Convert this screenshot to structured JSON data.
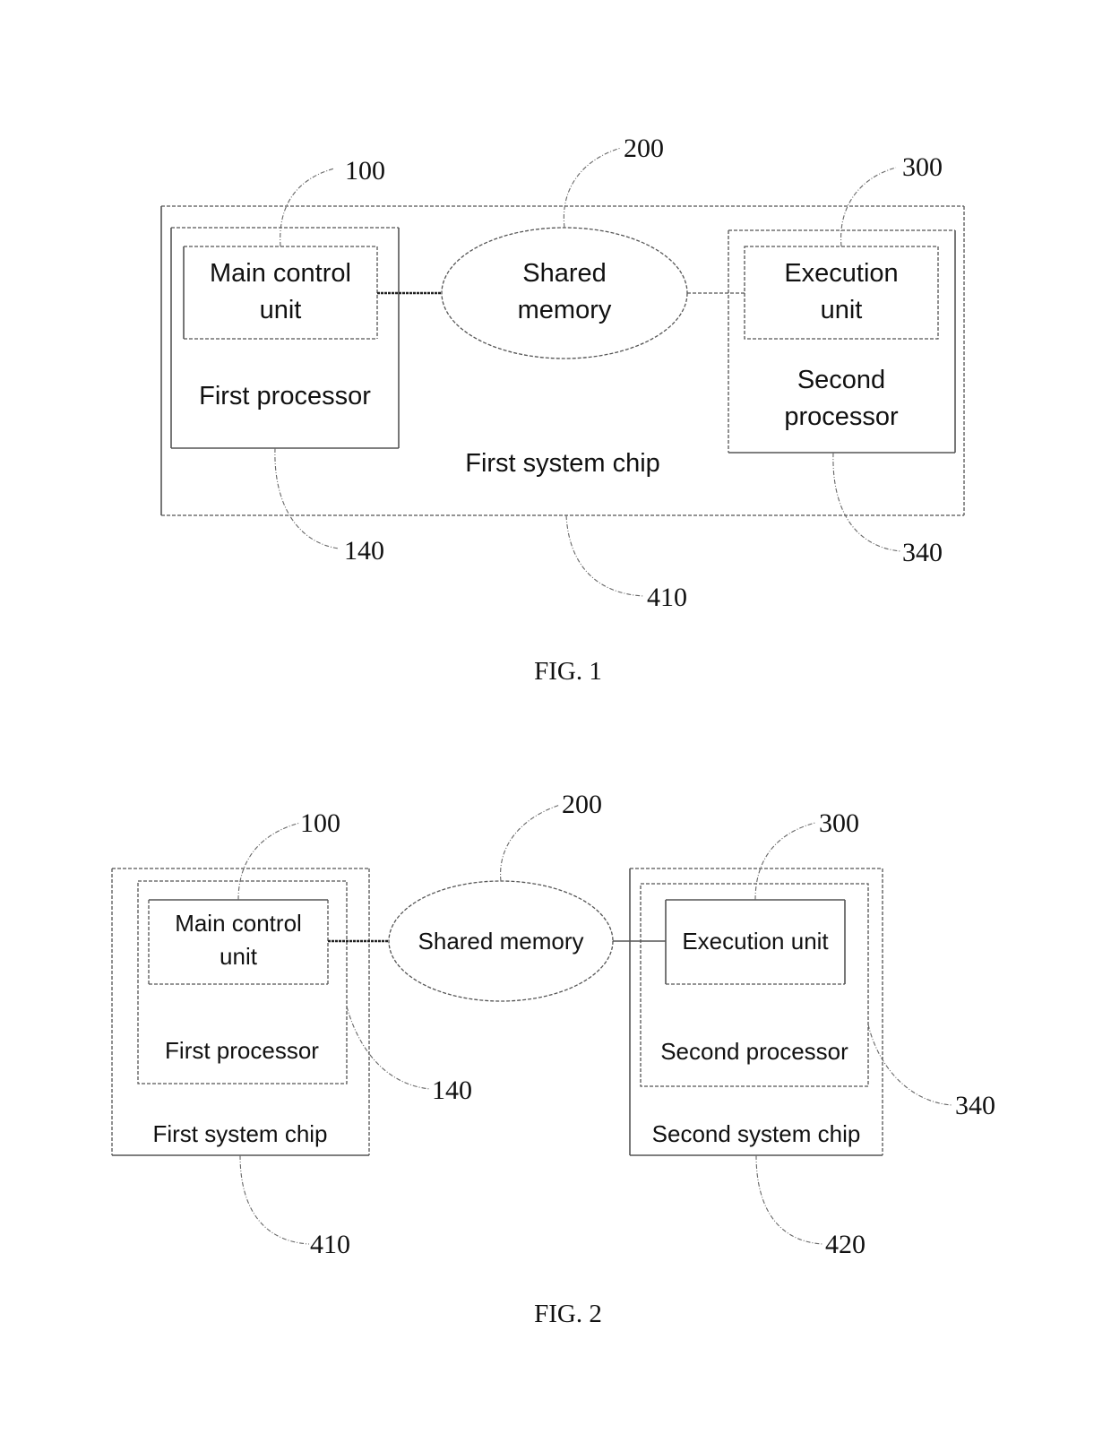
{
  "figures": [
    {
      "caption": "FIG. 1",
      "nodes": {
        "main_control_unit": {
          "lines": [
            "Main control",
            "unit"
          ],
          "ref": "100"
        },
        "first_processor": {
          "lines": [
            "First processor"
          ],
          "ref": "140"
        },
        "shared_memory": {
          "lines": [
            "Shared",
            "memory"
          ],
          "ref": "200"
        },
        "execution_unit": {
          "lines": [
            "Execution",
            "unit"
          ],
          "ref": "300"
        },
        "second_processor": {
          "lines": [
            "Second",
            "processor"
          ],
          "ref": "340"
        },
        "first_system_chip": {
          "lines": [
            "First system chip"
          ],
          "ref": "410"
        }
      },
      "edges": [
        {
          "from": "main_control_unit",
          "to": "shared_memory",
          "style": "heavy-dotted"
        },
        {
          "from": "shared_memory",
          "to": "execution_unit",
          "style": "dashed"
        }
      ]
    },
    {
      "caption": "FIG. 2",
      "nodes": {
        "main_control_unit": {
          "lines": [
            "Main control",
            "unit"
          ],
          "ref": "100"
        },
        "first_processor": {
          "lines": [
            "First processor"
          ],
          "ref": "140"
        },
        "first_system_chip": {
          "lines": [
            "First system chip"
          ],
          "ref": "410"
        },
        "shared_memory": {
          "lines": [
            "Shared memory"
          ],
          "ref": "200"
        },
        "execution_unit": {
          "lines": [
            "Execution unit"
          ],
          "ref": "300"
        },
        "second_processor": {
          "lines": [
            "Second processor"
          ],
          "ref": "340"
        },
        "second_system_chip": {
          "lines": [
            "Second system chip"
          ],
          "ref": "420"
        }
      },
      "edges": [
        {
          "from": "main_control_unit",
          "to": "shared_memory",
          "style": "heavy-dotted"
        },
        {
          "from": "shared_memory",
          "to": "execution_unit",
          "style": "solid"
        }
      ]
    }
  ]
}
